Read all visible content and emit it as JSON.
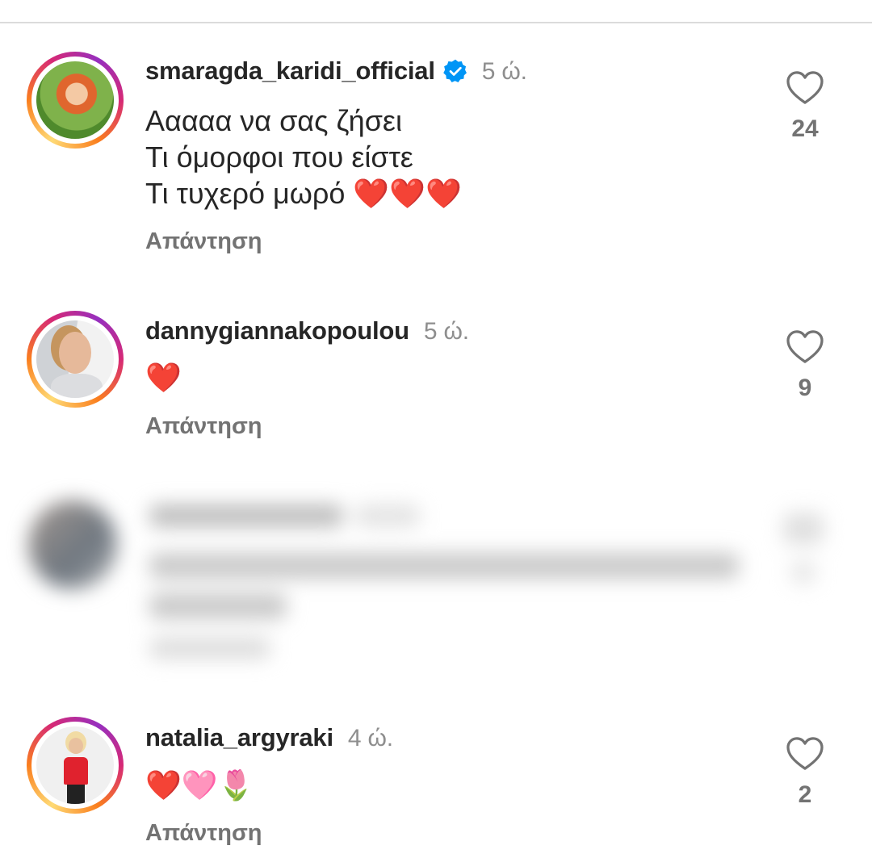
{
  "comments": [
    {
      "username": "smaragda_karidi_official",
      "verified": true,
      "time": "5 ώ.",
      "lines": "Ααααα να σας ζήσει\nΤι όμορφοι που είστε\nΤι τυχερό μωρό ❤️❤️❤️",
      "reply": "Απάντηση",
      "likes": "24"
    },
    {
      "username": "dannygiannakopoulou",
      "verified": false,
      "time": "5 ώ.",
      "lines": "❤️",
      "reply": "Απάντηση",
      "likes": "9"
    },
    {
      "username": "natalia_argyraki",
      "verified": false,
      "time": "4 ώ.",
      "lines": "❤️🩷🌷",
      "reply": "Απάντηση",
      "likes": "2"
    }
  ],
  "icons": {
    "like": "heart-outline-icon",
    "verified": "verified-badge-icon"
  },
  "colors": {
    "verified_blue": "#0095f6",
    "secondary_text": "#737373",
    "time_text": "#8e8e8e"
  }
}
